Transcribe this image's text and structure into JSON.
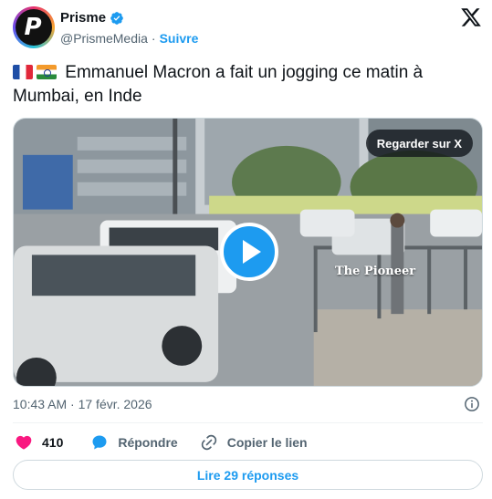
{
  "author": {
    "avatar_letter": "P",
    "display_name": "Prisme",
    "handle": "@PrismeMedia",
    "separator": "·",
    "follow_label": "Suivre",
    "verified_icon": "verified-badge-icon"
  },
  "tweet": {
    "flags": [
      "flag-france-icon",
      "flag-india-icon"
    ],
    "text": "Emmanuel Macron a fait un jogging ce matin à Mumbai, en Inde"
  },
  "media": {
    "watch_label": "Regarder sur X",
    "watermark": "The Pioneer",
    "play_icon": "play-icon"
  },
  "meta": {
    "timestamp": "10:43 AM · 17 févr. 2026",
    "info_icon": "info-icon"
  },
  "actions": {
    "like_count": "410",
    "reply_label": "Répondre",
    "copy_link_label": "Copier le lien"
  },
  "replies_button": {
    "label": "Lire 29 réponses"
  },
  "colors": {
    "accent": "#1d9bf0",
    "like": "#f91880",
    "text_primary": "#0f1419",
    "text_secondary": "#536471"
  }
}
